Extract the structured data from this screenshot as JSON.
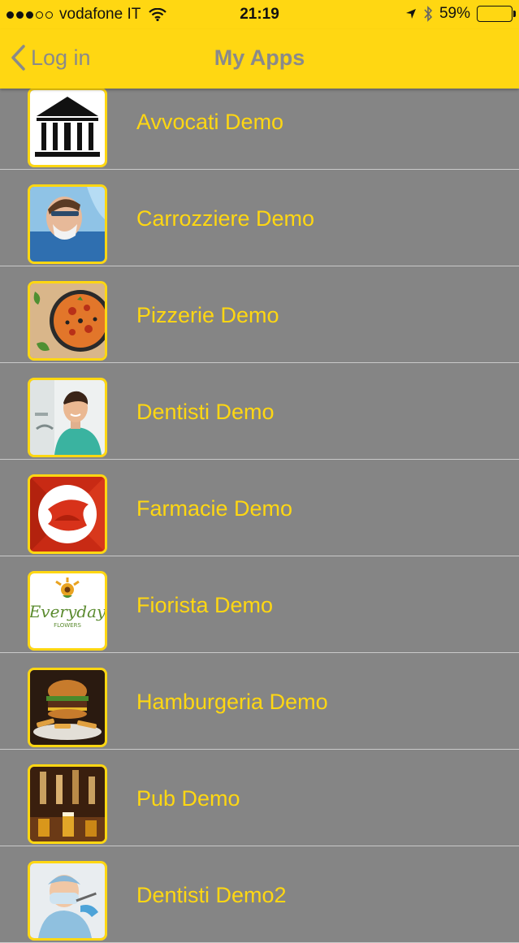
{
  "status_bar": {
    "carrier": "vodafone IT",
    "time": "21:19",
    "battery": "59%",
    "battery_level": 0.59,
    "signal_bars_filled": 3,
    "signal_bars_total": 5,
    "icons": [
      "wifi-icon",
      "location-arrow-icon",
      "bluetooth-icon",
      "battery-icon"
    ]
  },
  "nav": {
    "back_label": "Log in",
    "title": "My Apps"
  },
  "colors": {
    "accent": "#FFD712",
    "background": "#858585",
    "nav_text": "#8a8a8a",
    "separator": "#c9c9c9"
  },
  "apps": [
    {
      "name": "Avvocati Demo",
      "icon": "courthouse-icon"
    },
    {
      "name": "Carrozziere Demo",
      "icon": "mechanic-photo-icon"
    },
    {
      "name": "Pizzerie Demo",
      "icon": "pizza-photo-icon"
    },
    {
      "name": "Dentisti Demo",
      "icon": "dentist-photo-icon"
    },
    {
      "name": "Farmacie Demo",
      "icon": "pharmacy-logo-icon"
    },
    {
      "name": "Fiorista Demo",
      "icon": "everyday-flowers-logo-icon",
      "logo_text": "Everyday FLOWERS"
    },
    {
      "name": "Hamburgeria Demo",
      "icon": "burger-photo-icon"
    },
    {
      "name": "Pub Demo",
      "icon": "beer-taps-photo-icon"
    },
    {
      "name": "Dentisti Demo2",
      "icon": "dentist-photo-icon"
    }
  ]
}
